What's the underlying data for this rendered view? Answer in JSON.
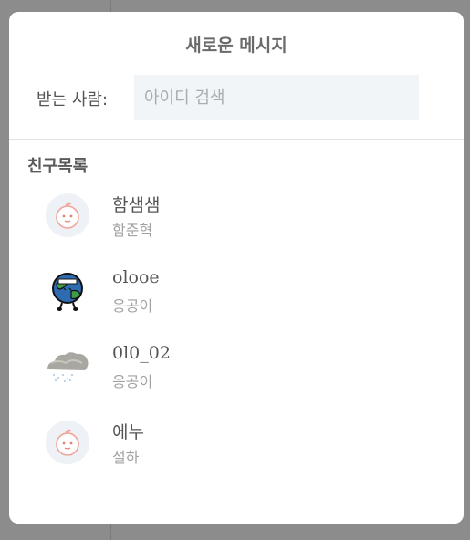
{
  "modal": {
    "title": "새로운 메시지",
    "to_label": "받는 사람:",
    "search_placeholder": "아이디 검색",
    "search_value": ""
  },
  "friends_section": {
    "title": "친구목록",
    "items": [
      {
        "name": "함샘샘",
        "sub": "함준혁",
        "avatar_icon": "default-baby-avatar-icon"
      },
      {
        "name": "olooe",
        "sub": "응공이",
        "avatar_icon": "earth-character-avatar-icon"
      },
      {
        "name": "0l0_02",
        "sub": "응공이",
        "avatar_icon": "rain-cloud-avatar-icon"
      },
      {
        "name": "에누",
        "sub": "설하",
        "avatar_icon": "default-baby-avatar-icon"
      }
    ]
  },
  "colors": {
    "overlay": "#9a9a9a",
    "input_bg": "#f2f5f8",
    "avatar_bg": "#eef2f6",
    "muted_text": "#a2a2a2"
  }
}
